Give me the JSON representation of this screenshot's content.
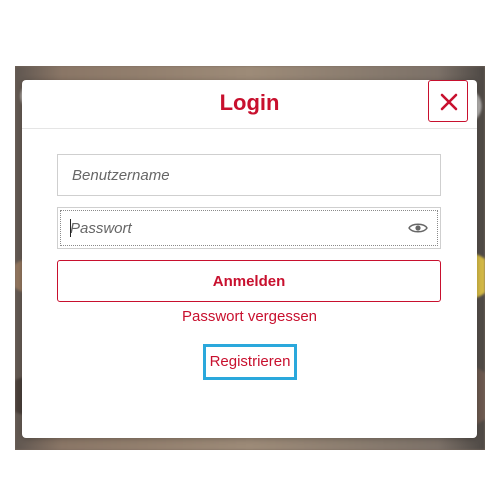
{
  "dialog": {
    "title": "Login",
    "close_icon": "close-icon"
  },
  "form": {
    "username_placeholder": "Benutzername",
    "password_placeholder": "Passwort",
    "password_toggle_icon": "eye-icon",
    "login_label": "Anmelden",
    "forgot_label": "Passwort vergessen",
    "register_label": "Registrieren"
  },
  "colors": {
    "brand": "#c8102e",
    "focus_highlight": "#2aa8dc"
  }
}
